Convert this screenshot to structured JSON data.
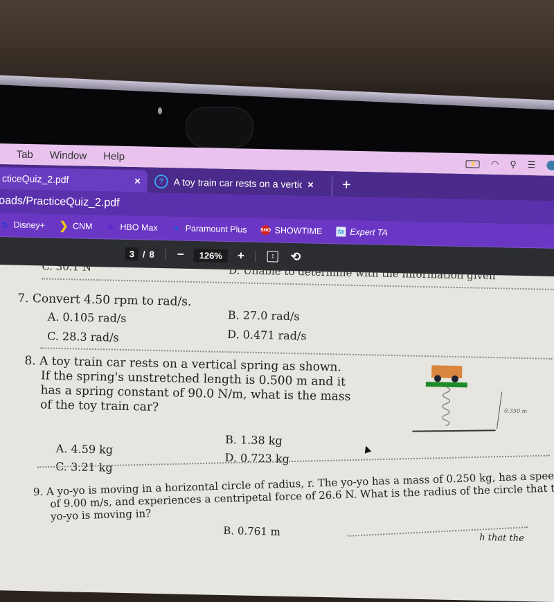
{
  "menubar": {
    "items": [
      "Tab",
      "Window",
      "Help"
    ],
    "status_icons": [
      "battery-charging-icon",
      "wifi-icon",
      "search-icon",
      "control-center-icon",
      "siri-icon"
    ]
  },
  "tabs": [
    {
      "label": "cticeQuiz_2.pdf",
      "active": true,
      "close": "×"
    },
    {
      "label": "A toy train car rests on a vertic",
      "active": false,
      "close": "×",
      "icon": "help-circle-icon"
    }
  ],
  "new_tab": "+",
  "address": "oads/PracticeQuiz_2.pdf",
  "bookmarks": [
    {
      "label": "Disney+",
      "icon": "disney-icon",
      "color": "#2a3bd6"
    },
    {
      "label": "CNM",
      "icon": "cnm-chevron-icon",
      "color": "#f2c21b"
    },
    {
      "label": "HBO Max",
      "icon": "hbo-max-icon",
      "color": "#5b1fd6"
    },
    {
      "label": "Paramount Plus",
      "icon": "paramount-icon",
      "color": "#1f57e0"
    },
    {
      "label": "SHOWTIME",
      "icon": "showtime-icon",
      "color": "#d32121"
    },
    {
      "label": "Expert TA",
      "icon": "expert-ta-icon",
      "color": "#2f8fd8"
    }
  ],
  "pdf_toolbar": {
    "page_current": "3",
    "page_sep": "/",
    "page_total": "8",
    "zoom_out": "−",
    "zoom_level": "126%",
    "zoom_in": "+",
    "fit_icon": "fit-page-icon",
    "rotate_icon": "rotate-icon"
  },
  "document": {
    "cutoff_prev_left": "C. 30.1 N",
    "cutoff_prev_right": "D. Unable to determine with the information given",
    "q7": {
      "text": "7. Convert 4.50 rpm to rad/s.",
      "options": {
        "A": "A. 0.105 rad/s",
        "B": "B. 27.0 rad/s",
        "C": "C. 28.3 rad/s",
        "D": "D. 0.471 rad/s"
      }
    },
    "q8": {
      "lines": [
        "8. A toy train car rests on a vertical spring as shown.",
        "If the spring's unstretched length is 0.500 m and it",
        "has a spring constant of 90.0 N/m, what is the mass",
        "of the toy train car?"
      ],
      "diagram_label": "0.350 m",
      "options": {
        "A": "A. 4.59 kg",
        "B": "B. 1.38 kg",
        "C": "C. 3.21 kg",
        "D": "D. 0.723 kg"
      }
    },
    "q9": {
      "lines": [
        "9. A yo-yo is moving in a horizontal circle of radius, r.  The yo-yo has a mass of 0.250 kg, has a speed",
        "of 9.00 m/s, and experiences a centripetal force of 26.6 N. What is the radius of the circle that the",
        "yo-yo is moving in?"
      ],
      "options": {
        "B": "B. 0.761 m"
      }
    },
    "q10_cutoff": "h that the"
  }
}
